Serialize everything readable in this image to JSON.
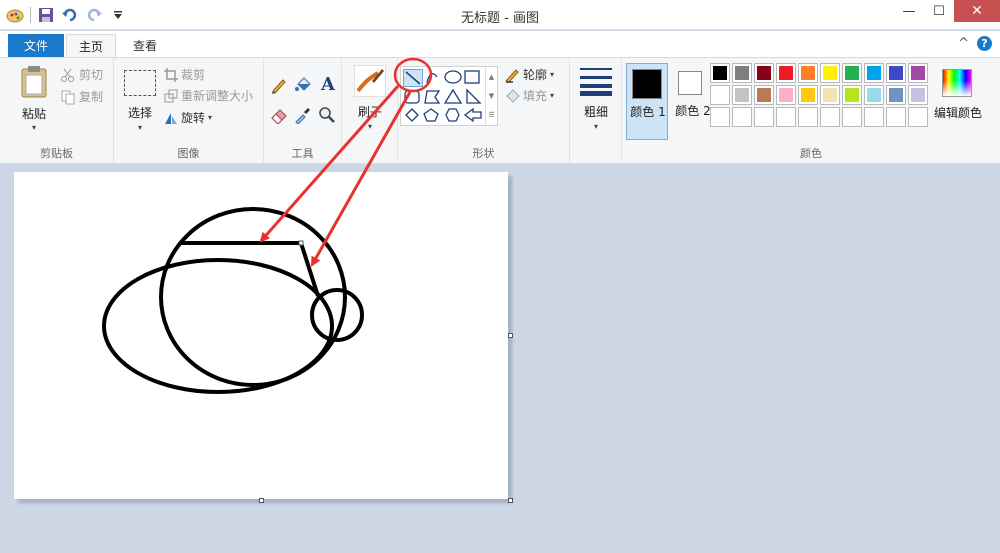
{
  "window": {
    "title": "无标题 - 画图",
    "minimize": "—",
    "maximize": "☐",
    "close": "✕"
  },
  "tabs": {
    "file": "文件",
    "home": "主页",
    "view": "查看",
    "collapse": "^",
    "help": "?"
  },
  "clipboard": {
    "paste": "粘贴",
    "cut": "剪切",
    "copy": "复制",
    "label": "剪贴板"
  },
  "image": {
    "select": "选择",
    "crop": "裁剪",
    "resize": "重新调整大小",
    "rotate": "旋转",
    "label": "图像"
  },
  "tools": {
    "text_icon": "A",
    "label": "工具"
  },
  "brushes": {
    "label": "刷子"
  },
  "shapes": {
    "outline": "轮廓",
    "fill": "填充",
    "label": "形状"
  },
  "size": {
    "label": "粗细"
  },
  "colors": {
    "color1": "颜色 1",
    "color2": "颜色 2",
    "edit": "编辑颜色",
    "label": "颜色",
    "palette_row1": [
      "#000000",
      "#7f7f7f",
      "#880015",
      "#ed1c24",
      "#ff7f27",
      "#fff200",
      "#22b14c",
      "#00a2e8",
      "#3f48cc",
      "#a349a4"
    ],
    "palette_row2": [
      "#ffffff",
      "#c3c3c3",
      "#b97a57",
      "#ffaec9",
      "#ffc90e",
      "#efe4b0",
      "#b5e61d",
      "#99d9ea",
      "#7092be",
      "#c8bfe7"
    ]
  },
  "annotation": {
    "highlight_color": "#e8322e"
  }
}
